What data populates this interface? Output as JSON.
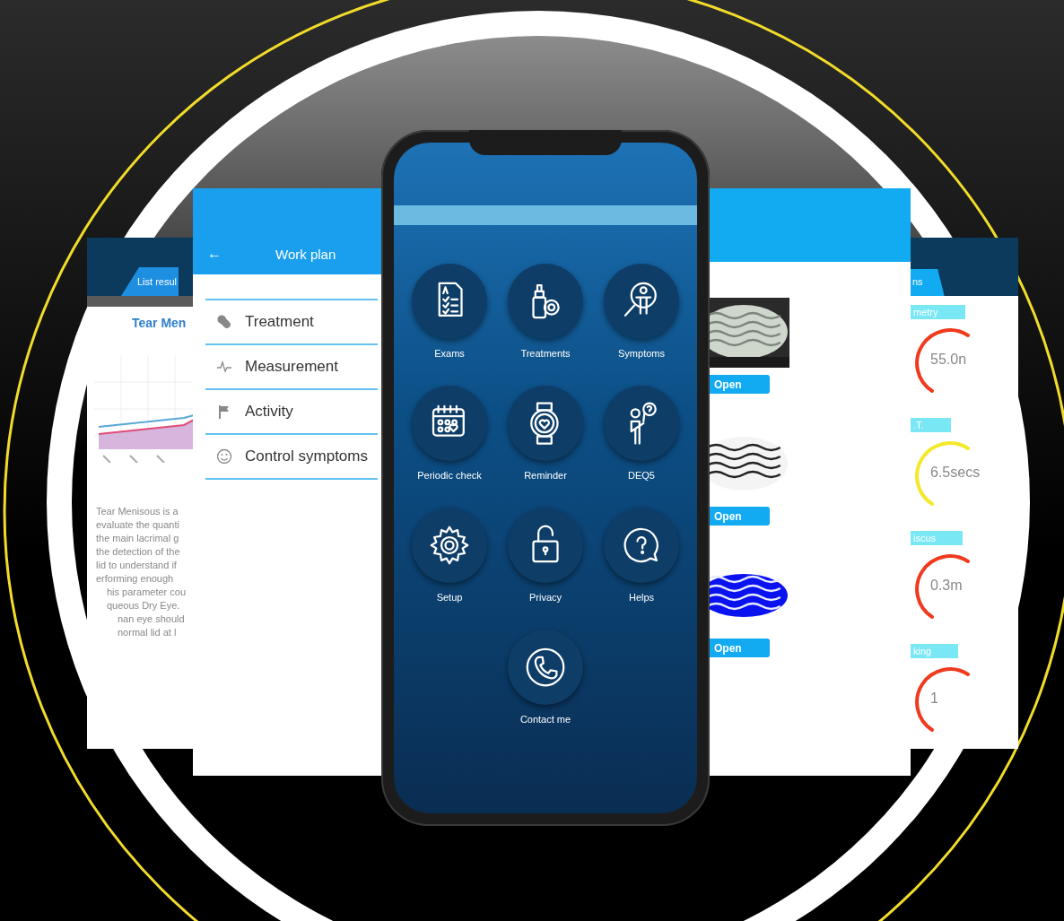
{
  "results_list_screen": {
    "tab": "List resul",
    "title": "Tear Men",
    "paragraph_lines": [
      "Tear Menisous is a",
      "evaluate the quanti",
      "the main lacrimal g",
      "the detection of the",
      "lid to understand if",
      "erforming enough",
      "his parameter cou",
      "queous Dry Eye.",
      "nan eye should",
      "normal  lid at l"
    ]
  },
  "work_plan_screen": {
    "back": "←",
    "title": "Work plan",
    "items": [
      {
        "label": "Treatment",
        "kind": "pill"
      },
      {
        "label": "Measurement",
        "kind": "pulse"
      },
      {
        "label": "Activity",
        "kind": "flag"
      },
      {
        "label": "Control symptoms",
        "kind": "smiley"
      }
    ]
  },
  "phone": {
    "menu": [
      {
        "label": "Exams",
        "kind": "exams"
      },
      {
        "label": "Treatments",
        "kind": "drops"
      },
      {
        "label": "Symptoms",
        "kind": "symptoms"
      },
      {
        "label": "Periodic check",
        "kind": "calendar"
      },
      {
        "label": "Reminder",
        "kind": "watch"
      },
      {
        "label": "DEQ5",
        "kind": "question-person"
      },
      {
        "label": "Setup",
        "kind": "gear"
      },
      {
        "label": "Privacy",
        "kind": "lock"
      },
      {
        "label": "Helps",
        "kind": "help"
      },
      {
        "label": "Contact me",
        "kind": "phone"
      }
    ]
  },
  "images_screen": {
    "entries": [
      {
        "kind": "picture",
        "button": "Open"
      },
      {
        "kind": "picture",
        "button": "Open"
      },
      {
        "kind": "picture",
        "button": "Open"
      }
    ]
  },
  "gauges_screen": {
    "tab": "ns",
    "gauges": [
      {
        "label": "metry",
        "reading": "55.0n",
        "color": "#f03a1e"
      },
      {
        "label": ".T.",
        "reading": "6.5secs",
        "color": "#f5e82a"
      },
      {
        "label": "iscus",
        "reading": "0.3m",
        "color": "#f03a1e"
      },
      {
        "label": "king",
        "reading": "1",
        "color": "#f03a1e"
      }
    ]
  }
}
